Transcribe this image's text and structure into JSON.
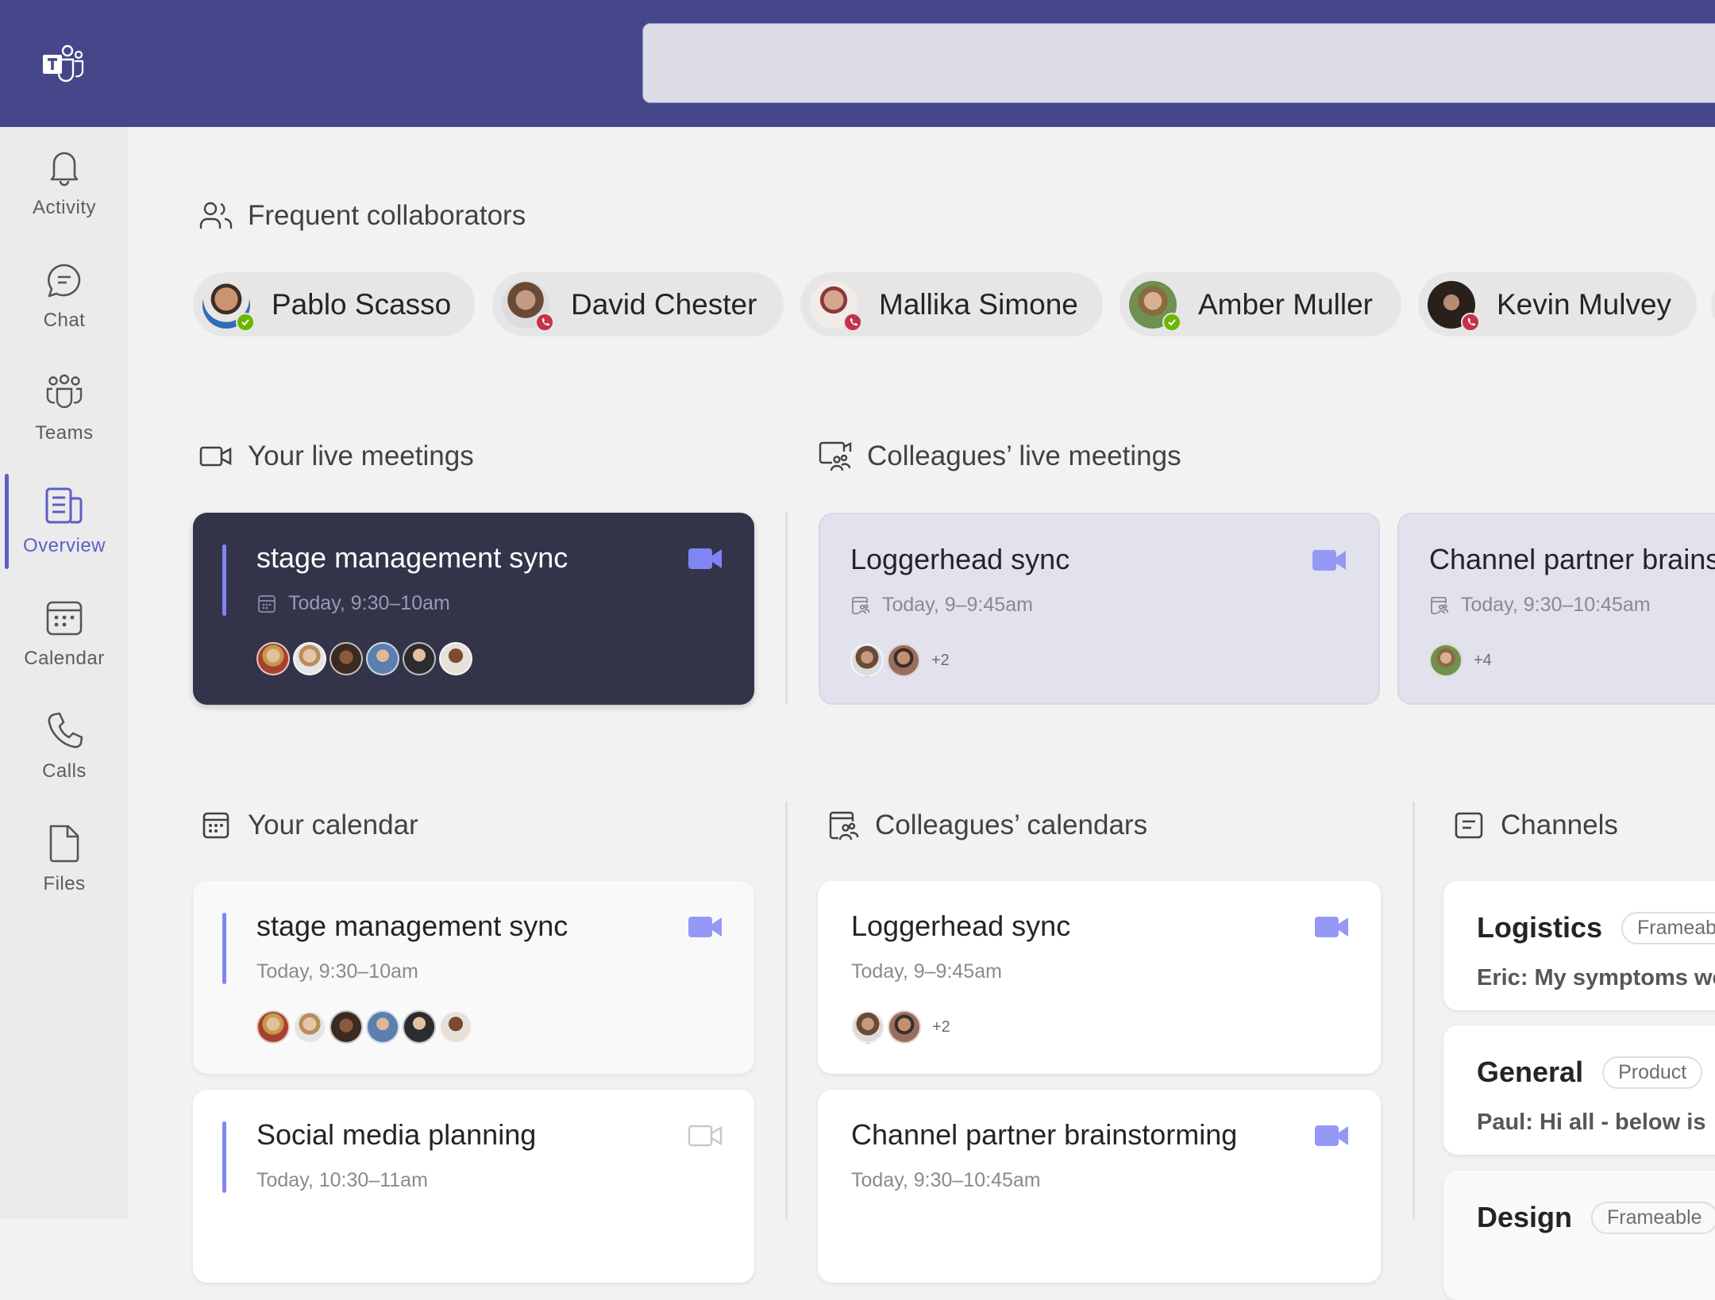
{
  "app": {
    "name": "Microsoft Teams",
    "logo_icon": "teams-logo-icon"
  },
  "search": {
    "placeholder": ""
  },
  "sidebar": {
    "items": [
      {
        "label": "Activity",
        "icon": "bell-icon",
        "active": false
      },
      {
        "label": "Chat",
        "icon": "chat-bubble-icon",
        "active": false
      },
      {
        "label": "Teams",
        "icon": "teams-people-icon",
        "active": false
      },
      {
        "label": "Overview",
        "icon": "overview-document-icon",
        "active": true
      },
      {
        "label": "Calendar",
        "icon": "calendar-icon",
        "active": false
      },
      {
        "label": "Calls",
        "icon": "phone-icon",
        "active": false
      },
      {
        "label": "Files",
        "icon": "file-icon",
        "active": false
      }
    ]
  },
  "collaborators": {
    "heading": "Frequent collaborators",
    "people": [
      {
        "name": "Pablo Scasso",
        "status": "available",
        "avatar_color": "#b58a6a"
      },
      {
        "name": "David Chester",
        "status": "in-call",
        "avatar_color": "#7a6152"
      },
      {
        "name": "Mallika Simone",
        "status": "in-call",
        "avatar_color": "#c9a08a"
      },
      {
        "name": "Amber Muller",
        "status": "available",
        "avatar_color": "#7d9a5c"
      },
      {
        "name": "Kevin Mulvey",
        "status": "in-call",
        "avatar_color": "#3b3029"
      }
    ]
  },
  "colors": {
    "accent": "#5b5fc7",
    "available": "#6bb700",
    "in_call": "#c4314b",
    "header": "#45478a"
  },
  "live_meetings": {
    "heading": "Your live meetings",
    "items": [
      {
        "title": "stage management sync",
        "time": "Today, 9:30–10am",
        "avatars": 6,
        "extra": ""
      }
    ]
  },
  "colleagues_live": {
    "heading": "Colleagues’ live meetings",
    "items": [
      {
        "title": "Loggerhead sync",
        "time": "Today, 9–9:45am",
        "avatars": 2,
        "extra": "+2"
      },
      {
        "title": "Channel partner brainstorming",
        "time": "Today, 9:30–10:45am",
        "avatars": 1,
        "extra": "+4"
      }
    ]
  },
  "your_calendar": {
    "heading": "Your calendar",
    "items": [
      {
        "title": "stage management sync",
        "time": "Today, 9:30–10am",
        "video": true
      },
      {
        "title": "Social media planning",
        "time": "Today, 10:30–11am",
        "video": false
      }
    ]
  },
  "colleagues_calendars": {
    "heading": "Colleagues’ calendars",
    "items": [
      {
        "title": "Loggerhead sync",
        "time": "Today, 9–9:45am",
        "extra": "+2"
      },
      {
        "title": "Channel partner brainstorming",
        "time": "Today, 9:30–10:45am",
        "extra": ""
      }
    ]
  },
  "channels": {
    "heading": "Channels",
    "items": [
      {
        "name": "Logistics",
        "team": "Frameable",
        "last_message": "Eric: My symptoms were"
      },
      {
        "name": "General",
        "team": "Product",
        "last_message": "Paul: Hi all - below is"
      },
      {
        "name": "Design",
        "team": "Frameable",
        "last_message": ""
      }
    ]
  }
}
